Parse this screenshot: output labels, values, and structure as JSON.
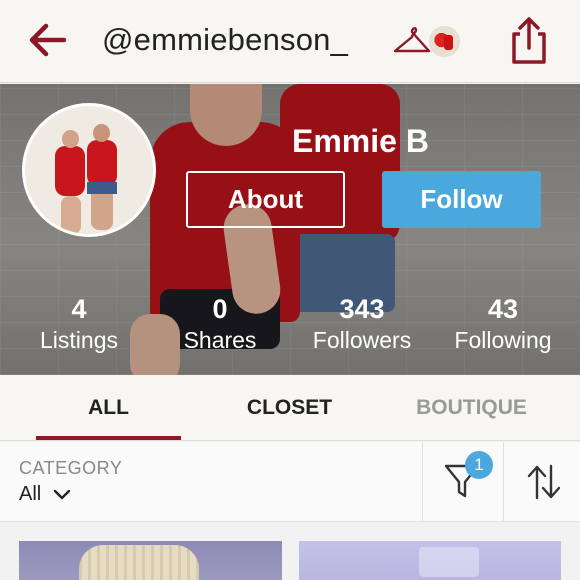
{
  "header": {
    "username": "@emmiebenson_",
    "back_icon": "back-arrow-icon",
    "hanger_icon": "hanger-icon",
    "share_icon": "share-icon",
    "accent_color": "#8b1a26"
  },
  "profile": {
    "display_name": "Emmie B",
    "about_label": "About",
    "follow_label": "Follow",
    "follow_color": "#4aa8dc",
    "stats": [
      {
        "value": "4",
        "label": "Listings"
      },
      {
        "value": "0",
        "label": "Shares"
      },
      {
        "value": "343",
        "label": "Followers"
      },
      {
        "value": "43",
        "label": "Following"
      }
    ]
  },
  "tabs": [
    {
      "label": "ALL",
      "active": true
    },
    {
      "label": "CLOSET",
      "active": false
    },
    {
      "label": "BOUTIQUE",
      "active": false
    }
  ],
  "filter": {
    "category_label": "CATEGORY",
    "category_value": "All",
    "filter_icon": "filter-funnel-icon",
    "filter_badge": "1",
    "sort_icon": "sort-arrows-icon"
  }
}
